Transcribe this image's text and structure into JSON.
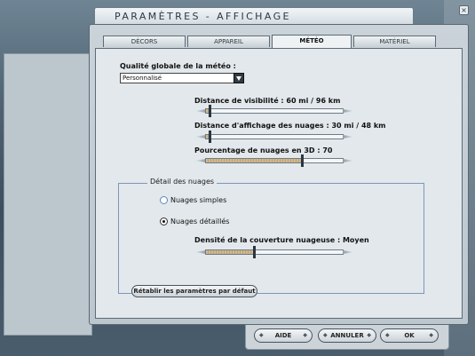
{
  "window": {
    "title": "PARAMÈTRES - AFFICHAGE",
    "close_glyph": "×"
  },
  "tabs": [
    {
      "label": "DÉCORS",
      "active": false
    },
    {
      "label": "APPAREIL",
      "active": false
    },
    {
      "label": "MÉTÉO",
      "active": true
    },
    {
      "label": "MATÉRIEL",
      "active": false
    }
  ],
  "meteo": {
    "quality_label": "Qualité globale de la météo :",
    "quality_value": "Personnalisé",
    "visibility": {
      "label": "Distance de visibilité : 60 mi / 96 km",
      "value_pct": 3
    },
    "cloud_distance": {
      "label": "Distance d'affichage des nuages : 30 mi / 48 km",
      "value_pct": 3
    },
    "cloud_3d": {
      "label": "Pourcentage de nuages en 3D : 70",
      "value_pct": 70
    }
  },
  "cloud_detail": {
    "group_title": "Détail des nuages",
    "options": [
      {
        "label": "Nuages simples",
        "checked": false
      },
      {
        "label": "Nuages détaillés",
        "checked": true
      }
    ],
    "density": {
      "label": "Densité de la couverture nuageuse : Moyen",
      "value_pct": 35
    }
  },
  "reset_button": "Rétablir les paramètres par défaut",
  "footer": {
    "help": "AIDE",
    "cancel": "ANNULER",
    "ok": "OK"
  },
  "colors": {
    "accent_fill": "#d3b88a",
    "frame": "#5a6874"
  }
}
